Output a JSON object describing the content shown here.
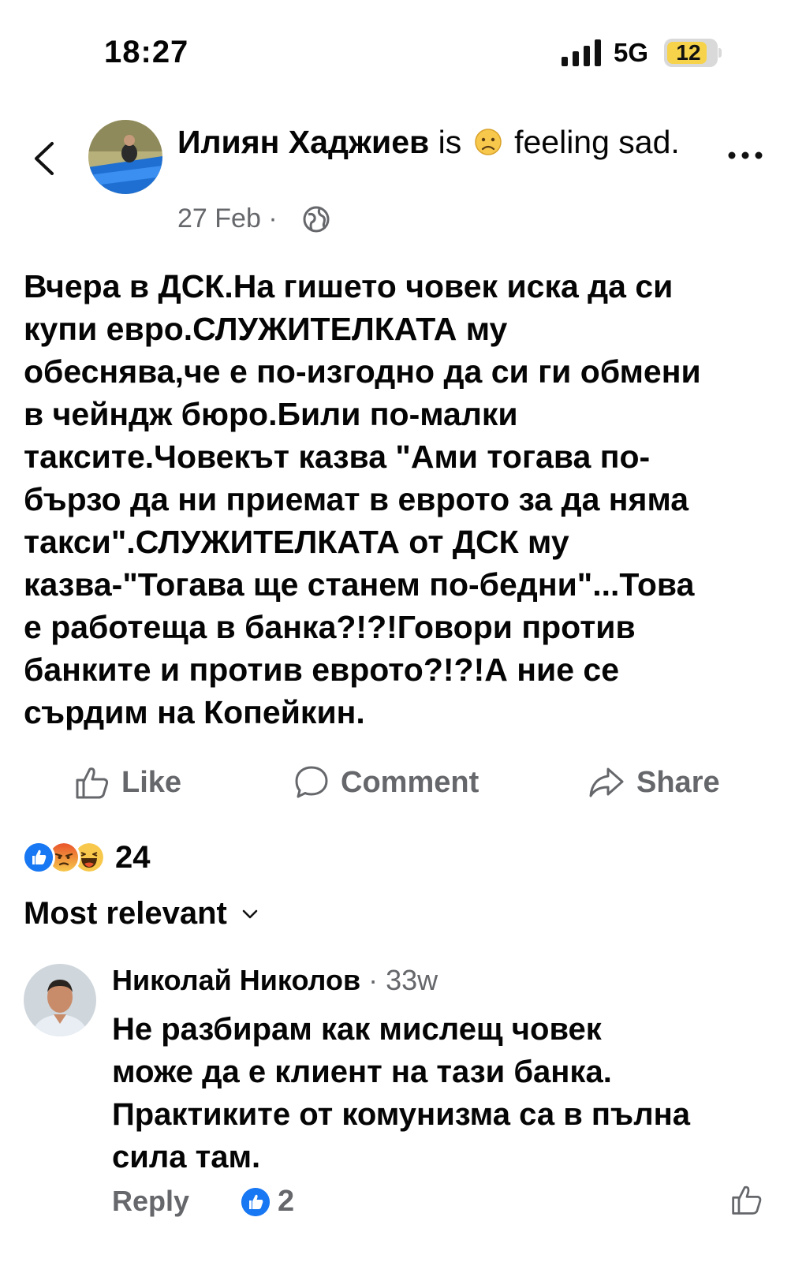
{
  "status_bar": {
    "time": "18:27",
    "network": "5G",
    "battery": "12"
  },
  "post": {
    "author": "Илиян Хаджиев",
    "is": "is",
    "feeling_emoji": "sad-face-icon",
    "feeling_label": "feeling sad.",
    "date": "27 Feb",
    "dot": "·",
    "audience_icon": "globe-icon",
    "text": "Вчера в ДСК.На гишето човек иска да си\nкупи евро.СЛУЖИТЕЛКАТА му\nобеснява,че е по-изгодно да си ги обмени\nв чейндж бюро.Били по-малки\nтаксите.Човекът казва \"Ами тогава по-\nбързо да ни приемат в еврото за да няма\nтакси\".СЛУЖИТЕЛКАТА от ДСК му\nказва-\"Тогава ще станем по-бедни\"...Това\nе работеща в банка?!?!Говори против\nбанките и против еврото?!?!А ние се\nсърдим на Копейкин."
  },
  "actions": {
    "like": "Like",
    "comment": "Comment",
    "share": "Share"
  },
  "reactions": {
    "types": [
      "like",
      "angry",
      "haha"
    ],
    "count": "24"
  },
  "sort": {
    "label": "Most relevant"
  },
  "comments": [
    {
      "author": "Николай Николов",
      "dot": "·",
      "time": "33w",
      "text": "Не разбирам как мислещ човек\nможе да е клиент на тази банка.\nПрактиките от комунизма са в пълна\nсила там.",
      "reply_label": "Reply",
      "like_count": "2"
    }
  ],
  "colors": {
    "text": "#050505",
    "secondary": "#65676b",
    "facebook_blue": "#1877f2",
    "battery_low": "#f6d34a"
  }
}
